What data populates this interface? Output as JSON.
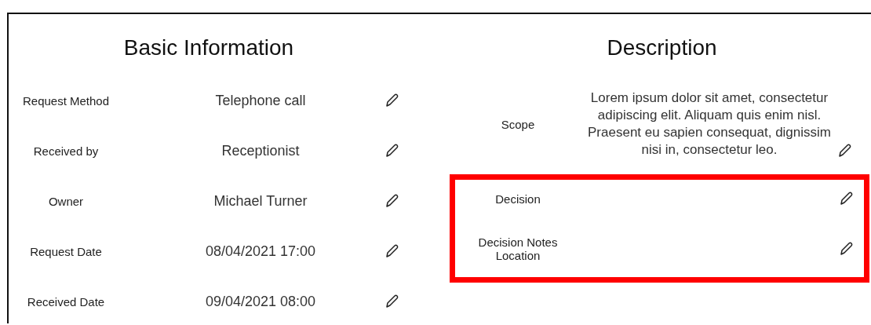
{
  "basic": {
    "title": "Basic Information",
    "fields": [
      {
        "label": "Request Method",
        "value": "Telephone call"
      },
      {
        "label": "Received by",
        "value": "Receptionist"
      },
      {
        "label": "Owner",
        "value": "Michael Turner"
      },
      {
        "label": "Request Date",
        "value": "08/04/2021 17:00"
      },
      {
        "label": "Received Date",
        "value": "09/04/2021 08:00"
      }
    ]
  },
  "description": {
    "title": "Description",
    "fields": [
      {
        "label": "Scope",
        "value": "Lorem ipsum dolor sit amet, consectetur adipiscing elit. Aliquam quis enim nisl. Praesent eu sapien consequat, dignissim nisi in, consectetur leo."
      }
    ],
    "highlight": {
      "highlighted": true,
      "fields": [
        {
          "label": "Decision"
        },
        {
          "label": "Decision Notes Location"
        }
      ]
    }
  }
}
